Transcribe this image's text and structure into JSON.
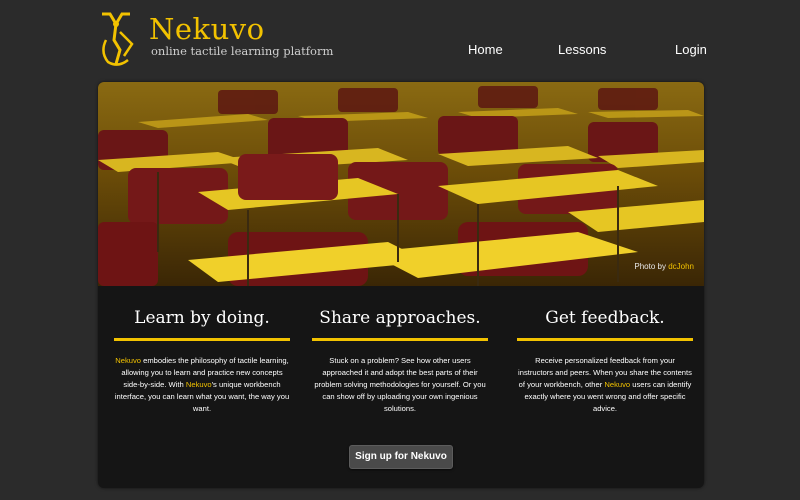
{
  "brand": {
    "name": "Nekuvo",
    "tagline": "online tactile learning platform",
    "accent": "#f2c200"
  },
  "nav": {
    "home": "Home",
    "lessons": "Lessons",
    "login": "Login"
  },
  "hero": {
    "credit_prefix": "Photo by ",
    "credit_author": "dcJohn"
  },
  "features": [
    {
      "title": "Learn by doing.",
      "parts": [
        "Nekuvo",
        " embodies the philosophy of tactile learning, allowing you to learn and practice new concepts side-by-side. With ",
        "Nekuvo",
        "'s unique workbench interface, you can learn what you want, the way you want."
      ]
    },
    {
      "title": "Share approaches.",
      "text": "Stuck on a problem? See how other users approached it and adopt the best parts of their problem solving methodologies for yourself. Or you can show off by uploading your own ingenious solutions."
    },
    {
      "title": "Get feedback.",
      "parts": [
        "Receive personalized feedback from your instructors and peers. When you share the contents of your workbench, other ",
        "Nekuvo",
        " users can identify exactly where you went wrong and offer specific advice."
      ]
    }
  ],
  "cta": {
    "label": "Sign up for Nekuvo"
  }
}
